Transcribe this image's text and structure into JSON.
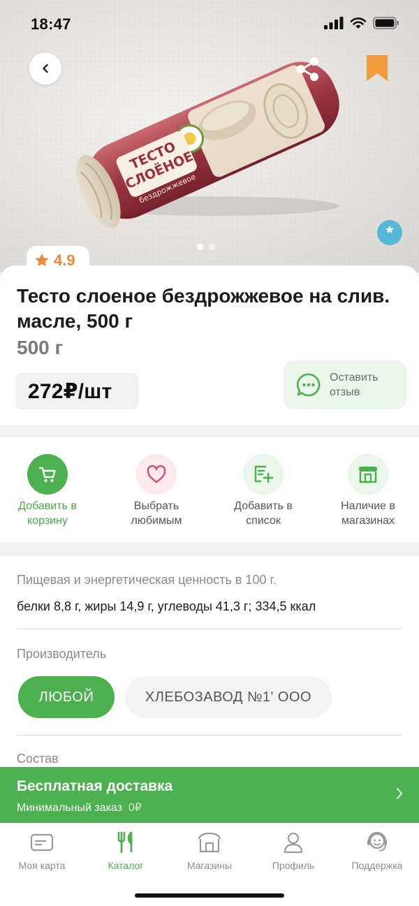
{
  "status_bar": {
    "time": "18:47"
  },
  "hero": {
    "package_text_1": "ТЕСТО",
    "package_text_2": "СЛОЁНОЕ",
    "package_text_3": "бездрожжевое",
    "images_count": 2,
    "active_image": 1
  },
  "product": {
    "rating": "4.9",
    "title": "Тесто слоеное бездрожжевое на слив. масле, 500 г",
    "weight": "500 г",
    "price": "272₽/шт",
    "review_button": "Оставить отзыв"
  },
  "actions": [
    {
      "label": "Добавить в корзину",
      "icon": "cart-icon"
    },
    {
      "label": "Выбрать любимым",
      "icon": "heart-icon"
    },
    {
      "label": "Добавить в список",
      "icon": "list-add-icon"
    },
    {
      "label": "Наличие в магазинах",
      "icon": "store-icon"
    }
  ],
  "details": {
    "nutrition_title": "Пищевая и энергетическая ценность в 100 г.",
    "nutrition_value": "белки 8,8 г, жиры 14,9 г, углеводы 41,3 г; 334,5 ккал",
    "manufacturer_title": "Производитель",
    "manufacturer_options": [
      "ЛЮБОЙ",
      "ХЛЕБОЗАВОД №1' ООО"
    ],
    "composition_title": "Состав"
  },
  "delivery": {
    "title": "Бесплатная доставка",
    "subtitle": "Минимальный заказ",
    "amount": "0₽"
  },
  "tabbar": {
    "items": [
      {
        "label": "Моя карта",
        "icon": "card-icon",
        "active": false
      },
      {
        "label": "Каталог",
        "icon": "cutlery-icon",
        "active": true
      },
      {
        "label": "Магазины",
        "icon": "store-icon",
        "active": false
      },
      {
        "label": "Профиль",
        "icon": "profile-icon",
        "active": false
      },
      {
        "label": "Поддержка",
        "icon": "support-icon",
        "active": false
      }
    ]
  },
  "colors": {
    "brand_green": "#4caf50",
    "rating_orange": "#ea8a3a",
    "bookmark_orange": "#f09a3e",
    "snow_badge_blue": "#58b6d6"
  }
}
